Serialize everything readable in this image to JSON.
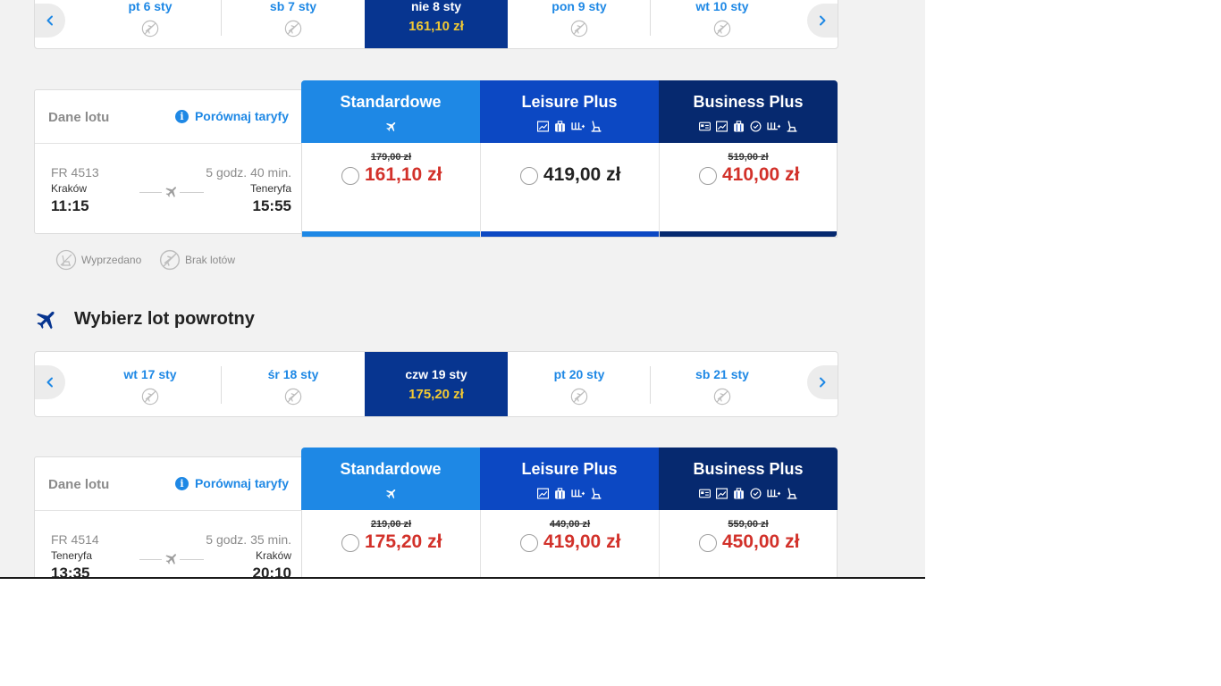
{
  "colors": {
    "standard": "#1e88e5",
    "leisure": "#0c48c3",
    "business": "#06296f",
    "date_active": "#073590",
    "price_sale": "#d2312a",
    "date_price": "#f1c933",
    "link": "#1e88e5"
  },
  "outbound": {
    "dates": [
      {
        "label": "pt 6 sty",
        "icon": "no-flights-icon"
      },
      {
        "label": "sb 7 sty",
        "icon": "no-flights-icon"
      },
      {
        "label": "nie 8 sty",
        "price": "161,10 zł",
        "active": true
      },
      {
        "label": "pon 9 sty",
        "icon": "no-flights-icon"
      },
      {
        "label": "wt 10 sty",
        "icon": "no-flights-icon"
      }
    ],
    "flight": {
      "header": "Dane lotu",
      "compare": "Porównaj taryfy",
      "number": "FR 4513",
      "duration": "5 godz. 40 min.",
      "from_city": "Kraków",
      "to_city": "Teneryfa",
      "dep_time": "11:15",
      "arr_time": "15:55"
    },
    "fares": [
      {
        "name": "Standardowe",
        "old": "179,00 zł",
        "price": "161,10 zł",
        "sale": true
      },
      {
        "name": "Leisure Plus",
        "old": "",
        "price": "419,00 zł",
        "sale": false
      },
      {
        "name": "Business Plus",
        "old": "519,00 zł",
        "price": "410,00 zł",
        "sale": true
      }
    ]
  },
  "legend": {
    "sold_out": "Wyprzedano",
    "no_flights": "Brak lotów"
  },
  "return_section": {
    "title": "Wybierz lot powrotny"
  },
  "inbound": {
    "dates": [
      {
        "label": "wt 17 sty",
        "icon": "no-flights-icon"
      },
      {
        "label": "śr 18 sty",
        "icon": "no-flights-icon"
      },
      {
        "label": "czw 19 sty",
        "price": "175,20 zł",
        "active": true
      },
      {
        "label": "pt 20 sty",
        "icon": "no-flights-icon"
      },
      {
        "label": "sb 21 sty",
        "icon": "no-flights-icon"
      }
    ],
    "flight": {
      "header": "Dane lotu",
      "compare": "Porównaj taryfy",
      "number": "FR 4514",
      "duration": "5 godz. 35 min.",
      "from_city": "Teneryfa",
      "to_city": "Kraków",
      "dep_time": "13:35",
      "arr_time": "20:10"
    },
    "fares": [
      {
        "name": "Standardowe",
        "old": "219,00 zł",
        "price": "175,20 zł",
        "sale": true
      },
      {
        "name": "Leisure Plus",
        "old": "449,00 zł",
        "price": "419,00 zł",
        "sale": true
      },
      {
        "name": "Business Plus",
        "old": "559,00 zł",
        "price": "450,00 zł",
        "sale": true
      }
    ]
  }
}
